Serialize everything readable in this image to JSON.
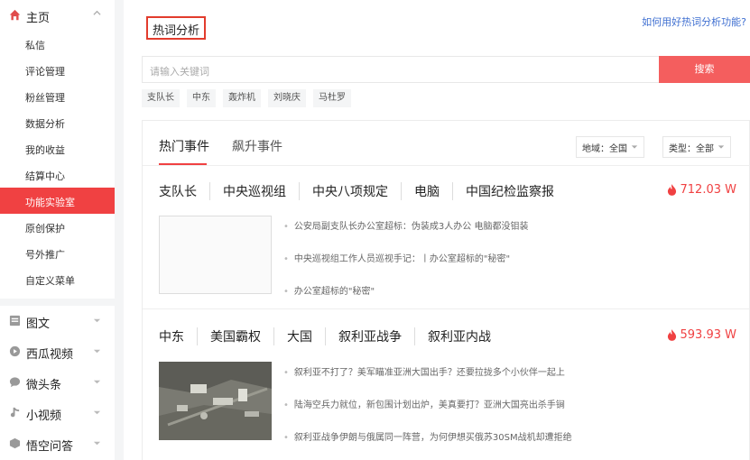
{
  "sidebar": {
    "home": {
      "label": "主页",
      "icon": "home-icon"
    },
    "sub_items": [
      {
        "label": "私信"
      },
      {
        "label": "评论管理"
      },
      {
        "label": "粉丝管理"
      },
      {
        "label": "数据分析"
      },
      {
        "label": "我的收益"
      },
      {
        "label": "结算中心"
      },
      {
        "label": "功能实验室",
        "active": true
      },
      {
        "label": "原创保护"
      },
      {
        "label": "号外推广"
      },
      {
        "label": "自定义菜单"
      }
    ],
    "groups": [
      {
        "label": "图文",
        "icon": "article-icon"
      },
      {
        "label": "西瓜视频",
        "icon": "play-circle-icon"
      },
      {
        "label": "微头条",
        "icon": "chat-bubble-icon"
      },
      {
        "label": "小视频",
        "icon": "music-note-icon"
      },
      {
        "label": "悟空问答",
        "icon": "answer-icon"
      }
    ]
  },
  "main": {
    "title": "热词分析",
    "help_link": "如何用好热词分析功能?",
    "search": {
      "placeholder": "请输入关键词",
      "button": "搜索"
    },
    "hot_tags": [
      "支队长",
      "中东",
      "轰炸机",
      "刘晓庆",
      "马杜罗"
    ],
    "tabs": [
      {
        "label": "热门事件",
        "active": true
      },
      {
        "label": "飙升事件",
        "active": false
      }
    ],
    "filters": {
      "region": {
        "label": "地域：全国"
      },
      "type": {
        "label": "类型：全部"
      }
    },
    "events": [
      {
        "keywords": [
          "支队长",
          "中央巡视组",
          "中央八项规定",
          "电脑",
          "中国纪检监察报"
        ],
        "heat": "712.03 W",
        "headlines": [
          "公安局副支队长办公室超标：伪装成3人办公 电脑都没钼装",
          "中央巡视组工作人员巡视手记：丨办公室超标的\"秘密\"",
          "办公室超标的\"秘密\""
        ]
      },
      {
        "keywords": [
          "中东",
          "美国霸权",
          "大国",
          "叙利亚战争",
          "叙利亚内战"
        ],
        "heat": "593.93 W",
        "headlines": [
          "叙利亚不打了？美军瞄准亚洲大国出手？还要拉拢多个小伙伴一起上",
          "陆海空兵力就位，新包围计划出炉，美真要打？亚洲大国亮出杀手锏",
          "叙利亚战争伊朗与俄属同一阵营，为何伊想买俄苏30SM战机却遭拒绝"
        ]
      }
    ],
    "colors": {
      "accent": "#f04142",
      "link": "#3f6fd1"
    }
  }
}
